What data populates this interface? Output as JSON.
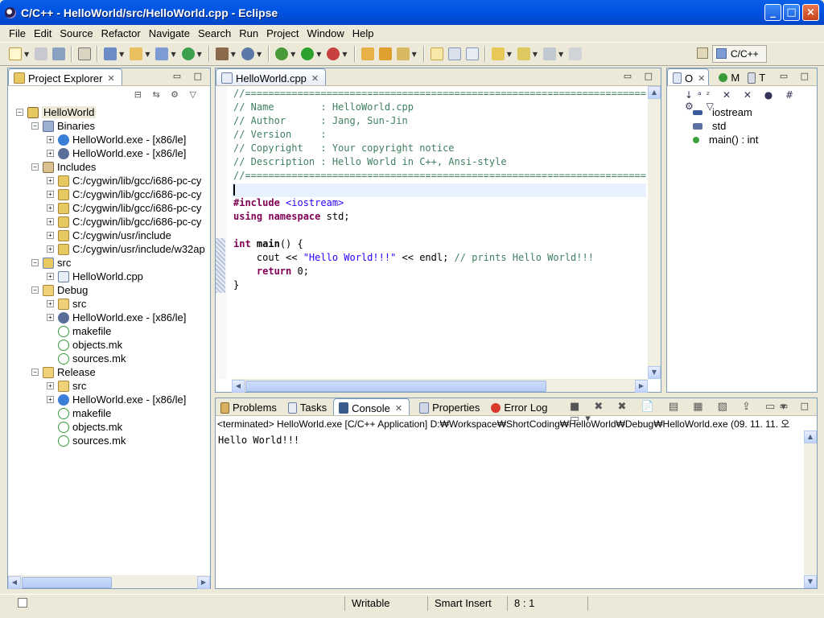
{
  "window": {
    "title": "C/C++ - HelloWorld/src/HelloWorld.cpp - Eclipse",
    "min": "_",
    "max": "□",
    "close": "×"
  },
  "menu": [
    "File",
    "Edit",
    "Source",
    "Refactor",
    "Navigate",
    "Search",
    "Run",
    "Project",
    "Window",
    "Help"
  ],
  "perspective": "C/C++",
  "explorer": {
    "tab": "Project Explorer",
    "tree": [
      {
        "label": "HelloWorld",
        "depth": 0,
        "exp": "−",
        "icon": "project-icon"
      },
      {
        "label": "Binaries",
        "depth": 1,
        "exp": "−",
        "icon": "binaries-icon"
      },
      {
        "label": "HelloWorld.exe - [x86/le]",
        "depth": 2,
        "exp": "+",
        "icon": "run-binary-icon"
      },
      {
        "label": "HelloWorld.exe - [x86/le]",
        "depth": 2,
        "exp": "+",
        "icon": "debug-binary-icon"
      },
      {
        "label": "Includes",
        "depth": 1,
        "exp": "−",
        "icon": "includes-icon"
      },
      {
        "label": "C:/cygwin/lib/gcc/i686-pc-cy",
        "depth": 2,
        "exp": "+",
        "icon": "include-folder-icon"
      },
      {
        "label": "C:/cygwin/lib/gcc/i686-pc-cy",
        "depth": 2,
        "exp": "+",
        "icon": "include-folder-icon"
      },
      {
        "label": "C:/cygwin/lib/gcc/i686-pc-cy",
        "depth": 2,
        "exp": "+",
        "icon": "include-folder-icon"
      },
      {
        "label": "C:/cygwin/lib/gcc/i686-pc-cy",
        "depth": 2,
        "exp": "+",
        "icon": "include-folder-icon"
      },
      {
        "label": "C:/cygwin/usr/include",
        "depth": 2,
        "exp": "+",
        "icon": "include-folder-icon"
      },
      {
        "label": "C:/cygwin/usr/include/w32ap",
        "depth": 2,
        "exp": "+",
        "icon": "include-folder-icon"
      },
      {
        "label": "src",
        "depth": 1,
        "exp": "−",
        "icon": "source-folder-icon"
      },
      {
        "label": "HelloWorld.cpp",
        "depth": 2,
        "exp": "+",
        "icon": "cpp-file-icon"
      },
      {
        "label": "Debug",
        "depth": 1,
        "exp": "−",
        "icon": "folder-icon"
      },
      {
        "label": "src",
        "depth": 2,
        "exp": "+",
        "icon": "folder-icon"
      },
      {
        "label": "HelloWorld.exe - [x86/le]",
        "depth": 2,
        "exp": "+",
        "icon": "debug-binary-icon"
      },
      {
        "label": "makefile",
        "depth": 2,
        "exp": "",
        "icon": "make-file-icon"
      },
      {
        "label": "objects.mk",
        "depth": 2,
        "exp": "",
        "icon": "make-file-icon"
      },
      {
        "label": "sources.mk",
        "depth": 2,
        "exp": "",
        "icon": "make-file-icon"
      },
      {
        "label": "Release",
        "depth": 1,
        "exp": "−",
        "icon": "folder-icon"
      },
      {
        "label": "src",
        "depth": 2,
        "exp": "+",
        "icon": "folder-icon"
      },
      {
        "label": "HelloWorld.exe - [x86/le]",
        "depth": 2,
        "exp": "+",
        "icon": "run-binary-icon"
      },
      {
        "label": "makefile",
        "depth": 2,
        "exp": "",
        "icon": "make-file-icon"
      },
      {
        "label": "objects.mk",
        "depth": 2,
        "exp": "",
        "icon": "make-file-icon"
      },
      {
        "label": "sources.mk",
        "depth": 2,
        "exp": "",
        "icon": "make-file-icon"
      }
    ]
  },
  "editor": {
    "tab": "HelloWorld.cpp",
    "lines": [
      [
        [
          "cmt",
          "//======================================================================"
        ]
      ],
      [
        [
          "cmt",
          "// Name        : HelloWorld.cpp"
        ]
      ],
      [
        [
          "cmt",
          "// Author      : Jang, Sun-Jin"
        ]
      ],
      [
        [
          "cmt",
          "// Version     :"
        ]
      ],
      [
        [
          "cmt",
          "// Copyright   : Your copyright notice"
        ]
      ],
      [
        [
          "cmt",
          "// Description : Hello World in C++, Ansi-style"
        ]
      ],
      [
        [
          "cmt",
          "//======================================================================"
        ]
      ],
      [
        [
          "",
          ""
        ]
      ],
      [
        [
          "kw",
          "#include"
        ],
        [
          "",
          " "
        ],
        [
          "inc",
          "<iostream>"
        ]
      ],
      [
        [
          "kw",
          "using"
        ],
        [
          "",
          " "
        ],
        [
          "kw",
          "namespace"
        ],
        [
          "",
          " std;"
        ]
      ],
      [
        [
          "",
          ""
        ]
      ],
      [
        [
          "kw",
          "int"
        ],
        [
          "",
          " "
        ],
        [
          "bold",
          "main"
        ],
        [
          "",
          "() {"
        ]
      ],
      [
        [
          "",
          "    cout << "
        ],
        [
          "str",
          "\"Hello World!!!\""
        ],
        [
          "",
          " << endl; "
        ],
        [
          "cmt",
          "// prints Hello World!!!"
        ]
      ],
      [
        [
          "",
          "    "
        ],
        [
          "kw",
          "return"
        ],
        [
          "",
          " 0;"
        ]
      ],
      [
        [
          "",
          "}"
        ]
      ]
    ]
  },
  "outline": {
    "tabs": [
      "O",
      "M",
      "T"
    ],
    "items": [
      {
        "label": "iostream",
        "icon": "include-icon"
      },
      {
        "label": "std",
        "icon": "namespace-icon"
      },
      {
        "label": "main() : int",
        "icon": "function-icon"
      }
    ]
  },
  "bottom": {
    "tabs": [
      "Problems",
      "Tasks",
      "Console",
      "Properties",
      "Error Log"
    ],
    "status_line": "<terminated> HelloWorld.exe [C/C++ Application] D:₩Workspace₩ShortCoding₩HelloWorld₩Debug₩HelloWorld.exe (09. 11. 11. 오",
    "output": "Hello World!!!"
  },
  "statusbar": {
    "writable": "Writable",
    "insert_mode": "Smart Insert",
    "position": "8 : 1"
  }
}
